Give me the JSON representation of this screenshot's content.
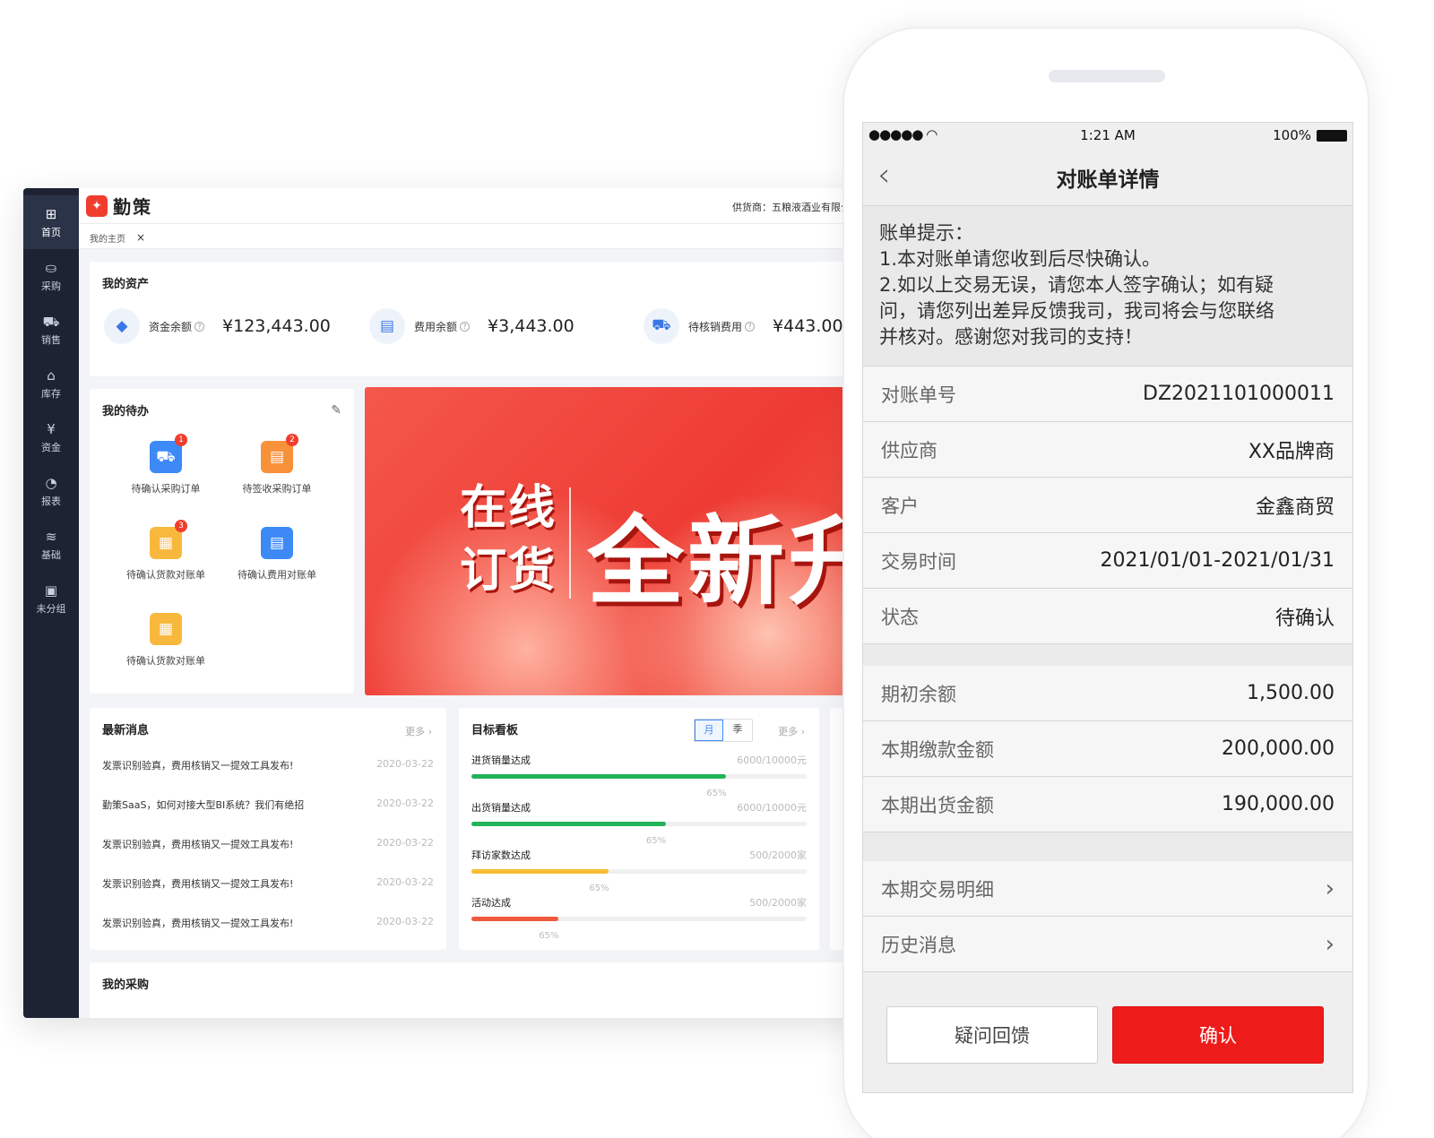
{
  "desktop": {
    "brand": "勤策",
    "brand_mark": "✦",
    "supplier": "供货商：五粮液酒业有限公司",
    "tab": "我的主页",
    "sidebar": [
      {
        "label": "首页",
        "icon": "grid-icon",
        "glyph": "⊞"
      },
      {
        "label": "采购",
        "icon": "purchase-icon",
        "glyph": "⛀"
      },
      {
        "label": "销售",
        "icon": "cart-icon",
        "glyph": "⛟"
      },
      {
        "label": "库存",
        "icon": "warehouse-icon",
        "glyph": "⌂"
      },
      {
        "label": "资金",
        "icon": "yen-icon",
        "glyph": "¥"
      },
      {
        "label": "报表",
        "icon": "pie-chart-icon",
        "glyph": "◔"
      },
      {
        "label": "基础",
        "icon": "layers-icon",
        "glyph": "≋"
      },
      {
        "label": "未分组",
        "icon": "image-icon",
        "glyph": "▣"
      }
    ],
    "assets": {
      "title": "我的资产",
      "items": [
        {
          "label": "资金余额",
          "value": "¥123,443.00"
        },
        {
          "label": "费用余额",
          "value": "¥3,443.00"
        },
        {
          "label": "待核销费用",
          "value": "¥443.00"
        }
      ]
    },
    "todo": {
      "title": "我的待办",
      "items": [
        {
          "label": "待确认采购订单",
          "badge": "1"
        },
        {
          "label": "待签收采购订单",
          "badge": "2"
        },
        {
          "label": "待确认货款对账单",
          "badge": "3"
        },
        {
          "label": "待确认费用对账单",
          "badge": ""
        },
        {
          "label": "待确认货款对账单",
          "badge": ""
        }
      ]
    },
    "banner": {
      "line1": "在线",
      "line2": "订货",
      "big": "全新升"
    },
    "news": {
      "title": "最新消息",
      "more": "更多 ›",
      "items": [
        {
          "text": "发票识别验真，费用核销又一提效工具发布!",
          "date": "2020-03-22"
        },
        {
          "text": "勤策SaaS，如何对接大型BI系统？我们有绝招",
          "date": "2020-03-22"
        },
        {
          "text": "发票识别验真，费用核销又一提效工具发布!",
          "date": "2020-03-22"
        },
        {
          "text": "发票识别验真，费用核销又一提效工具发布!",
          "date": "2020-03-22"
        },
        {
          "text": "发票识别验真，费用核销又一提效工具发布!",
          "date": "2020-03-22"
        }
      ]
    },
    "goals": {
      "title": "目标看板",
      "more": "更多 ›",
      "toggle": [
        "月",
        "季"
      ],
      "items": [
        {
          "name": "进货销量达成",
          "value": "6000/10000元",
          "pct": "65%",
          "progress": 0.76,
          "color": "#22b35a"
        },
        {
          "name": "出货销量达成",
          "value": "6000/10000元",
          "pct": "65%",
          "progress": 0.58,
          "color": "#22b35a"
        },
        {
          "name": "拜访家数达成",
          "value": "500/2000家",
          "pct": "65%",
          "progress": 0.41,
          "color": "#f7bd34"
        },
        {
          "name": "活动达成",
          "value": "500/2000家",
          "pct": "65%",
          "progress": 0.26,
          "color": "#f05a3c"
        }
      ]
    },
    "purchase_title": "我的采购"
  },
  "phone": {
    "status": {
      "signal": "●●●●● ",
      "wifi": "◠",
      "time": "1:21 AM",
      "battery": "100%"
    },
    "title": "对账单详情",
    "notice": {
      "l1": "账单提示：",
      "l2": "1.本对账单请您收到后尽快确认。",
      "l3": "2.如以上交易无误，请您本人签字确认；如有疑",
      "l4": "问，请您列出差异反馈我司，我司将会与您联络",
      "l5": "并核对。感谢您对我司的支持！"
    },
    "rows": [
      {
        "key": "对账单号",
        "value": "DZ2021101000011"
      },
      {
        "key": "供应商",
        "value": "XX品牌商"
      },
      {
        "key": "客户",
        "value": "金鑫商贸"
      },
      {
        "key": "交易时间",
        "value": "2021/01/01-2021/01/31"
      },
      {
        "key": "状态",
        "value": "待确认"
      },
      {
        "key": "期初余额",
        "value": "1,500.00"
      },
      {
        "key": "本期缴款金额",
        "value": "200,000.00"
      },
      {
        "key": "本期出货金额",
        "value": "190,000.00"
      },
      {
        "key": "本期交易明细",
        "value": ""
      },
      {
        "key": "历史消息",
        "value": ""
      }
    ],
    "buttons": {
      "feedback": "疑问回馈",
      "confirm": "确认"
    }
  }
}
